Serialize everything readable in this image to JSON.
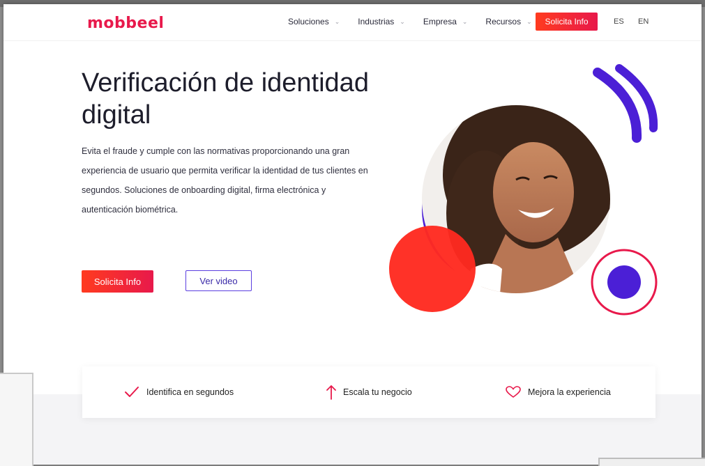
{
  "header": {
    "logo_text": "mobbeel",
    "nav": [
      {
        "label": "Soluciones"
      },
      {
        "label": "Industrias"
      },
      {
        "label": "Empresa"
      },
      {
        "label": "Recursos"
      }
    ],
    "cta_label": "Solicita Info",
    "lang_es": "ES",
    "lang_en": "EN"
  },
  "hero": {
    "title": "Verificación de identidad digital",
    "description": "Evita el fraude y cumple con las normativas proporcionando una gran experiencia de usuario que permita verificar la identidad de tus clientes en segundos. Soluciones de onboarding digital, firma electrónica y autenticación biométrica.",
    "primary_button": "Solicita Info",
    "secondary_button": "Ver video"
  },
  "features": [
    {
      "label": "Identifica en segundos",
      "icon": "check-icon"
    },
    {
      "label": "Escala tu negocio",
      "icon": "arrow-up-icon"
    },
    {
      "label": "Mejora la experiencia",
      "icon": "heart-icon"
    }
  ],
  "colors": {
    "brand_red": "#e8194b",
    "brand_orange": "#ff3b1f",
    "brand_purple": "#4b1fd6"
  }
}
